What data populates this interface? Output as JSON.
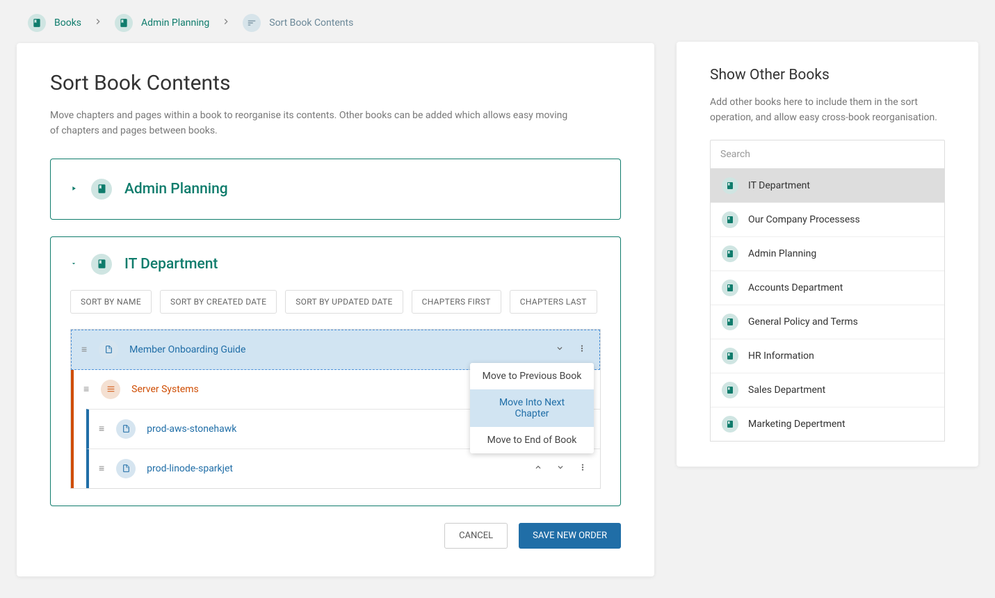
{
  "breadcrumb": {
    "items": [
      {
        "label": "Books"
      },
      {
        "label": "Admin Planning"
      },
      {
        "label": "Sort Book Contents"
      }
    ]
  },
  "page": {
    "title": "Sort Book Contents",
    "description": "Move chapters and pages within a book to reorganise its contents. Other books can be added which allows easy moving of chapters and pages between books."
  },
  "books": {
    "collapsed": {
      "title": "Admin Planning"
    },
    "expanded": {
      "title": "IT Department",
      "sort_buttons": {
        "name": "SORT BY NAME",
        "created": "SORT BY CREATED DATE",
        "updated": "SORT BY UPDATED DATE",
        "chapters_first": "CHAPTERS FIRST",
        "chapters_last": "CHAPTERS LAST"
      },
      "items": [
        {
          "type": "page",
          "label": "Member Onboarding Guide"
        },
        {
          "type": "chapter",
          "label": "Server Systems"
        },
        {
          "type": "nested-page",
          "label": "prod-aws-stonehawk"
        },
        {
          "type": "nested-page",
          "label": "prod-linode-sparkjet"
        }
      ]
    }
  },
  "dropdown": {
    "prev_book": "Move to Previous Book",
    "next_chapter": "Move Into Next Chapter",
    "end_book": "Move to End of Book"
  },
  "actions": {
    "cancel": "CANCEL",
    "save": "SAVE NEW ORDER"
  },
  "side": {
    "title": "Show Other Books",
    "description": "Add other books here to include them in the sort operation, and allow easy cross-book reorganisation.",
    "search_placeholder": "Search",
    "books": [
      {
        "label": "IT Department",
        "active": true
      },
      {
        "label": "Our Company Processess"
      },
      {
        "label": "Admin Planning"
      },
      {
        "label": "Accounts Department"
      },
      {
        "label": "General Policy and Terms"
      },
      {
        "label": "HR Information"
      },
      {
        "label": "Sales Department"
      },
      {
        "label": "Marketing Depertment"
      }
    ]
  },
  "colors": {
    "teal": "#0f7c6c",
    "blue": "#206ea7",
    "orange": "#cf4d03"
  }
}
